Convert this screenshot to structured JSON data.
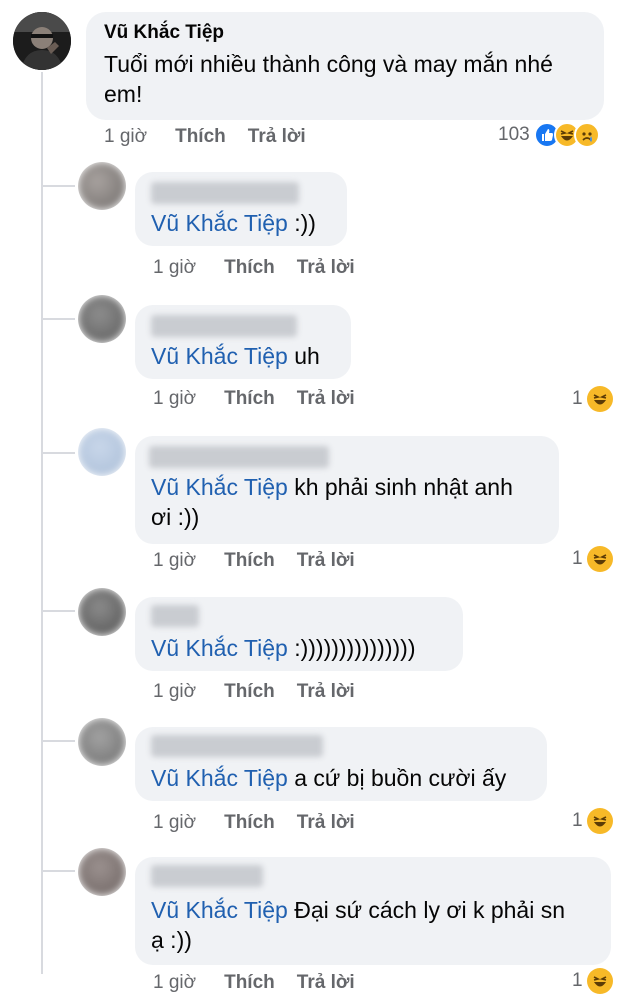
{
  "main_comment": {
    "author": "Vũ Khắc Tiệp",
    "text_line1": "Tuổi mới nhiều thành công và may mắn nhé",
    "text_line2": "em!",
    "time": "1 giờ",
    "like_label": "Thích",
    "reply_label": "Trả lời",
    "reaction_count": "103",
    "reaction_icons": [
      "like-icon",
      "haha-icon",
      "sad-icon"
    ]
  },
  "replies": [
    {
      "mention": "Vũ Khắc Tiệp",
      "text": ":))",
      "text_line2": "",
      "time": "1 giờ",
      "like_label": "Thích",
      "reply_label": "Trả lời",
      "reaction_count": ""
    },
    {
      "mention": "Vũ Khắc Tiệp",
      "text": "uh",
      "text_line2": "",
      "time": "1 giờ",
      "like_label": "Thích",
      "reply_label": "Trả lời",
      "reaction_count": "1"
    },
    {
      "mention": "Vũ Khắc Tiệp",
      "text": "kh phải sinh nhật anh",
      "text_line2": "ơi :))",
      "time": "1 giờ",
      "like_label": "Thích",
      "reply_label": "Trả lời",
      "reaction_count": "1"
    },
    {
      "mention": "Vũ Khắc Tiệp",
      "text": ":)))))))))))))))",
      "text_line2": "",
      "time": "1 giờ",
      "like_label": "Thích",
      "reply_label": "Trả lời",
      "reaction_count": ""
    },
    {
      "mention": "Vũ Khắc Tiệp",
      "text": "a cứ bị buồn cười ấy",
      "text_line2": "",
      "time": "1 giờ",
      "like_label": "Thích",
      "reply_label": "Trả lời",
      "reaction_count": "1"
    },
    {
      "mention": "Vũ Khắc Tiệp",
      "text": "Đại sứ cách ly ơi k phải sn",
      "text_line2": "ạ :))",
      "time": "1 giờ",
      "like_label": "Thích",
      "reply_label": "Trả lời",
      "reaction_count": "1"
    }
  ],
  "colors": {
    "bubble": "#f0f2f5",
    "mention": "#2060b0",
    "meta": "#65676b",
    "like_blue": "#1877f2",
    "haha_yellow": "#f7b928"
  }
}
